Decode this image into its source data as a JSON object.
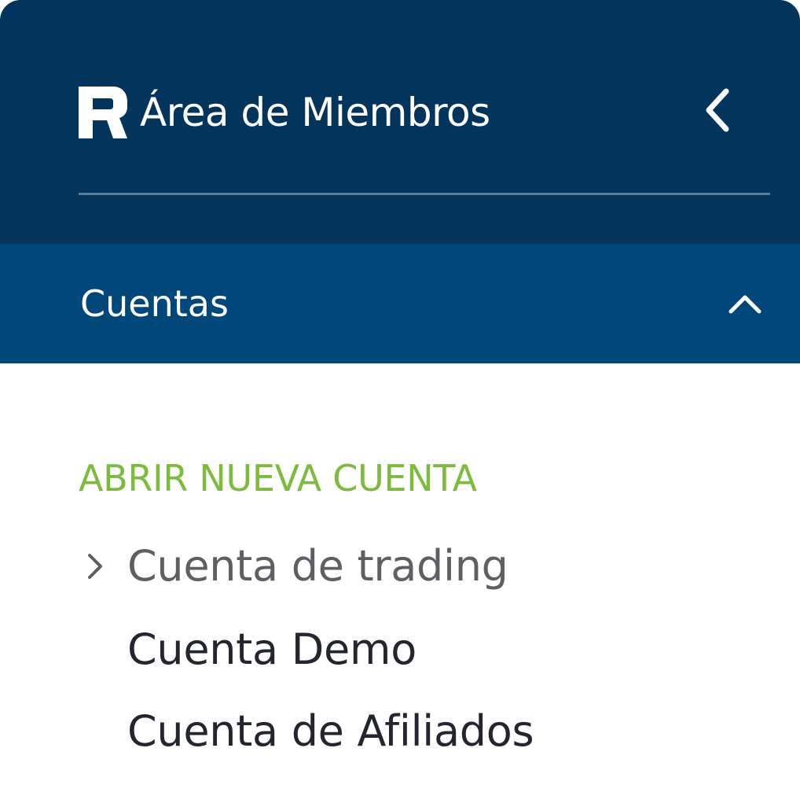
{
  "header": {
    "title": "Área de Miembros",
    "logo_icon": "roboforex-r-logo",
    "collapse_icon": "chevron-left-icon"
  },
  "section": {
    "title": "Cuentas",
    "expanded": true,
    "toggle_icon": "chevron-up-icon"
  },
  "menu": {
    "group_title": "ABRIR NUEVA CUENTA",
    "items": [
      {
        "label": "Cuenta de trading",
        "active": true,
        "icon": "chevron-right-icon"
      },
      {
        "label": "Cuenta Demo",
        "active": false
      },
      {
        "label": "Cuenta de Afiliados",
        "active": false
      }
    ]
  },
  "colors": {
    "header_bg": "#03355c",
    "section_bg": "#00477a",
    "divider": "#5a7d9c",
    "group_title": "#7cbb3c",
    "active_item": "#5e5f63",
    "item_text": "#23262e"
  }
}
